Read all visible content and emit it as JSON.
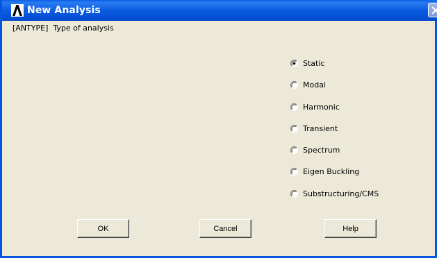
{
  "window": {
    "title": "New Analysis",
    "prompt": "[ANTYPE]  Type of analysis"
  },
  "analysis_types": [
    {
      "label": "Static",
      "selected": true
    },
    {
      "label": "Modal",
      "selected": false
    },
    {
      "label": "Harmonic",
      "selected": false
    },
    {
      "label": "Transient",
      "selected": false
    },
    {
      "label": "Spectrum",
      "selected": false
    },
    {
      "label": "Eigen Buckling",
      "selected": false
    },
    {
      "label": "Substructuring/CMS",
      "selected": false
    }
  ],
  "buttons": {
    "ok": "OK",
    "cancel": "Cancel",
    "help": "Help"
  },
  "colors": {
    "titlebar": "#0855dd",
    "dialog_bg": "#ece9d8"
  },
  "icons": {
    "app": "ansys-logo-icon",
    "close": "close-icon"
  }
}
